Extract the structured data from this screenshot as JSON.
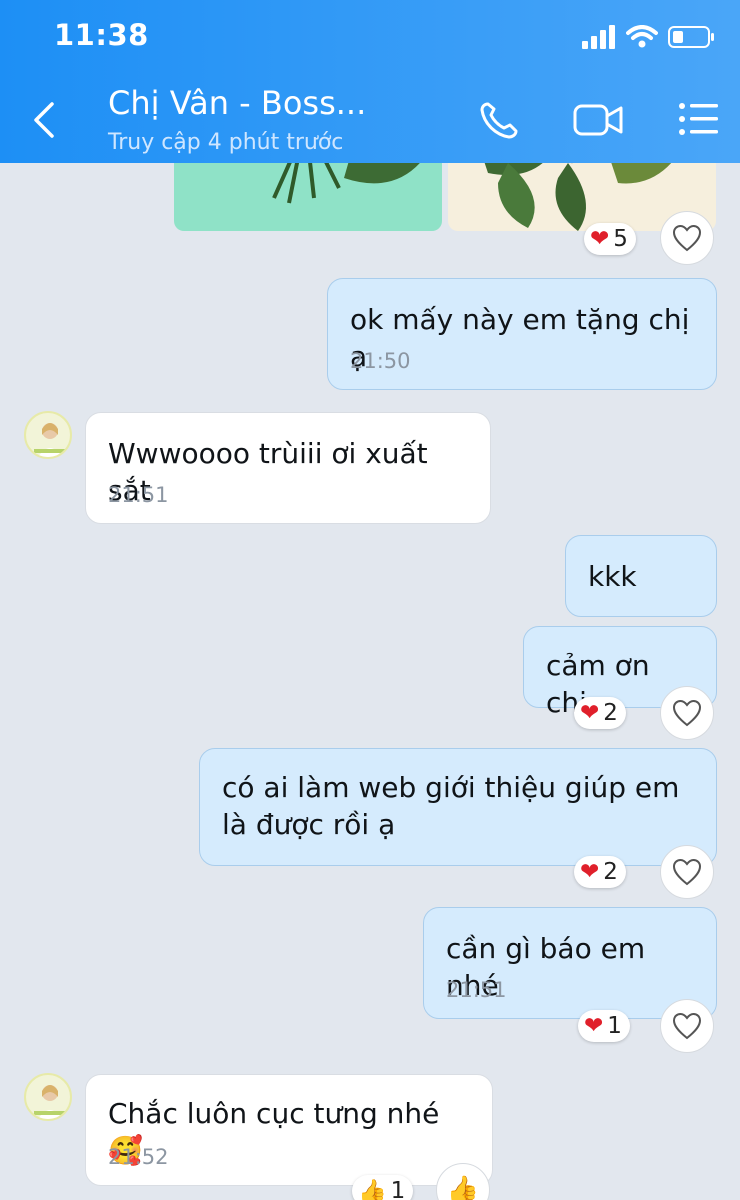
{
  "status_bar": {
    "time": "11:38"
  },
  "header": {
    "contact_name": "Chị Vân - Boss...",
    "last_seen": "Truy cập 4 phút trước"
  },
  "messages": [
    {
      "type": "sent",
      "text": "ok mấy này em tặng chị ạ",
      "time": "21:50"
    },
    {
      "type": "received",
      "text": "Wwwoooo trùiii ơi xuất sắt",
      "time": "21:51"
    },
    {
      "type": "sent",
      "text": "kkk"
    },
    {
      "type": "sent",
      "text": "cảm ơn chị"
    },
    {
      "type": "sent",
      "text": "có ai làm web giới thiệu giúp em là được rồi ạ"
    },
    {
      "type": "sent",
      "text": "cần gì báo em nhé",
      "time": "21:51"
    },
    {
      "type": "received",
      "text": "Chắc luôn cục tưng nhé🥰",
      "time": "21:52"
    }
  ],
  "reactions": {
    "image": {
      "icon": "heart",
      "count": "5"
    },
    "cam_on": {
      "icon": "heart",
      "count": "2"
    },
    "web": {
      "icon": "heart",
      "count": "2"
    },
    "can_gi": {
      "icon": "heart",
      "count": "1"
    },
    "chac_luon": {
      "icon": "thumbs-up",
      "count": "1"
    }
  },
  "colors": {
    "header": "#1d8ff5",
    "sent_bubble": "#d5ebfd",
    "received_bubble": "#ffffff",
    "heart": "#e0202b"
  }
}
